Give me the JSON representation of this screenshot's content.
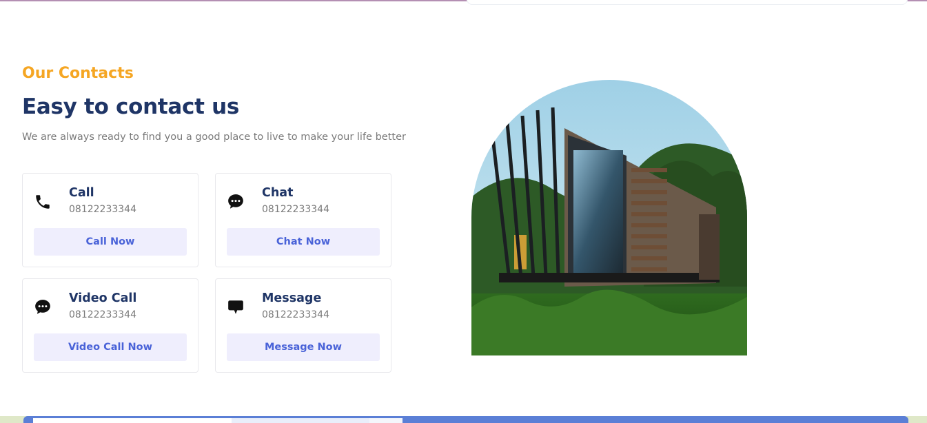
{
  "section": {
    "eyebrow": "Our Contacts",
    "heading": "Easy to contact us",
    "subtext": "We are always ready to find you a good place to live to make your life better"
  },
  "contacts": [
    {
      "title": "Call",
      "phone": "08122233344",
      "button": "Call Now",
      "icon": "phone-icon"
    },
    {
      "title": "Chat",
      "phone": "08122233344",
      "button": "Chat Now",
      "icon": "chat-bubble-icon"
    },
    {
      "title": "Video Call",
      "phone": "08122233344",
      "button": "Video Call Now",
      "icon": "chat-bubble-icon"
    },
    {
      "title": "Message",
      "phone": "08122233344",
      "button": "Message Now",
      "icon": "message-icon"
    }
  ],
  "colors": {
    "accent": "#f5a623",
    "heading": "#1f3566",
    "button_text": "#4a63d8",
    "button_bg": "#efeefd"
  }
}
